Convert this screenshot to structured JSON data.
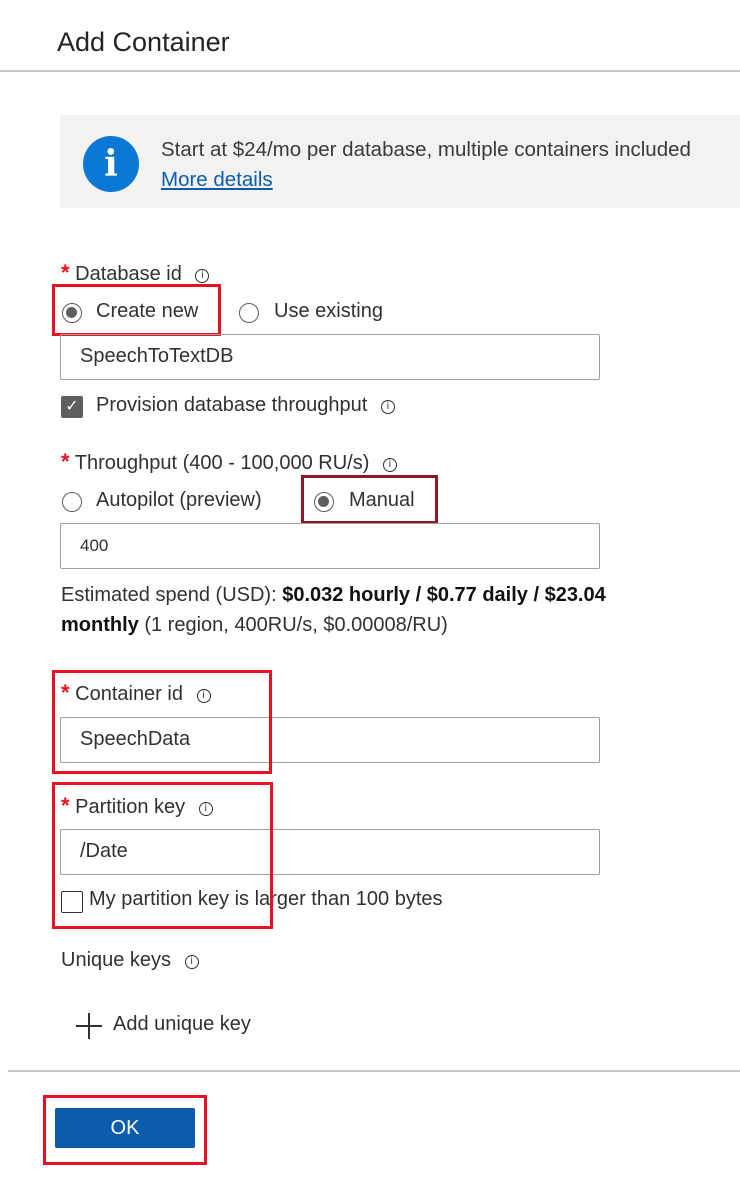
{
  "title": "Add Container",
  "banner": {
    "icon": "info-icon",
    "text": "Start at $24/mo per database, multiple containers included",
    "link": "More details"
  },
  "database": {
    "label": "Database id",
    "radio_create": "Create new",
    "radio_existing": "Use existing",
    "selected": "Create new",
    "value": "SpeechToTextDB",
    "provision_label": "Provision database throughput",
    "provision_checked": true
  },
  "throughput": {
    "label": "Throughput (400 - 100,000 RU/s)",
    "radio_autopilot": "Autopilot (preview)",
    "radio_manual": "Manual",
    "selected": "Manual",
    "value": "400"
  },
  "spend": {
    "prefix": "Estimated spend (USD):",
    "bold_part1": "$0.032 hourly / $0.77 daily / $23.04",
    "bold_part2": "monthly",
    "suffix": "(1 region, 400RU/s, $0.00008/RU)"
  },
  "container": {
    "label": "Container id",
    "value": "SpeechData"
  },
  "partition": {
    "label": "Partition key",
    "value": "/Date",
    "large_key_label": "My partition key is larger than 100 bytes",
    "large_key_checked": false
  },
  "unique_keys": {
    "label": "Unique keys",
    "add_label": "Add unique key"
  },
  "ok_button": "OK",
  "colors": {
    "accent": "#0b5cad",
    "info": "#0a78d4",
    "required": "#e81123",
    "highlight": "#e81123",
    "highlight_dark": "#8c1a25"
  }
}
